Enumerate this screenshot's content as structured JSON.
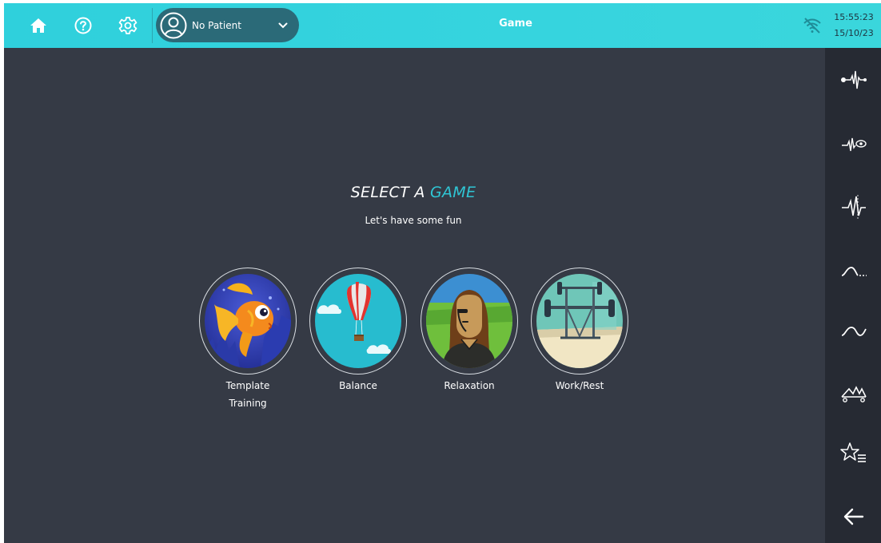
{
  "topbar": {
    "home_icon": "home-icon",
    "help_icon": "help-icon",
    "settings_icon": "gear-icon",
    "patient_selector": {
      "label": "No Patient",
      "icon": "user-circle-icon"
    },
    "title": "Game",
    "wifi_icon": "wifi-off-icon",
    "time": "15:55:23",
    "date": "15/10/23"
  },
  "sidebar": {
    "items": [
      {
        "icon": "ecg-probe-icon"
      },
      {
        "icon": "ecg-eye-icon"
      },
      {
        "icon": "ecg-spike-icon"
      },
      {
        "icon": "curve-dotted-icon"
      },
      {
        "icon": "wave-icon"
      },
      {
        "icon": "mountain-cart-icon"
      },
      {
        "icon": "star-list-icon"
      },
      {
        "icon": "back-arrow-icon"
      }
    ]
  },
  "main": {
    "heading_prefix": "SELECT A",
    "heading_accent": "GAME",
    "subheading": "Let's have some fun",
    "games": [
      {
        "label_line1": "Template",
        "label_line2": "Training",
        "image": "goldfish-image"
      },
      {
        "label_line1": "Balance",
        "label_line2": "",
        "image": "hot-air-balloon-image"
      },
      {
        "label_line1": "Relaxation",
        "label_line2": "",
        "image": "mona-lisa-image"
      },
      {
        "label_line1": "Work/Rest",
        "label_line2": "",
        "image": "barbell-image"
      }
    ]
  },
  "colors": {
    "topbar": "#33d2dd",
    "background": "#353a45",
    "sidebar": "#262a33",
    "accent": "#2fc6d5"
  }
}
